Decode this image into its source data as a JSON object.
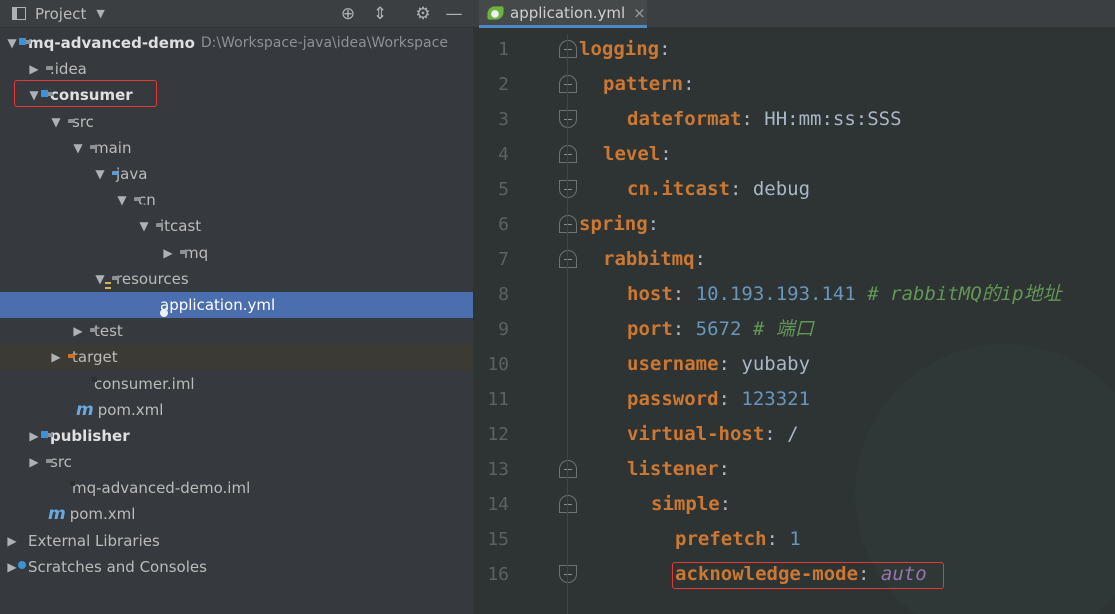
{
  "project": {
    "header_title": "Project",
    "icons": {
      "locate": "crosshair-icon",
      "collapse": "collapse-all-icon",
      "settings": "gear-icon",
      "hide": "minimize-icon"
    },
    "tree": [
      {
        "label": "mq-advanced-demo",
        "path": "D:\\Workspace-java\\idea\\Workspace"
      },
      {
        "label": ".idea"
      },
      {
        "label": "consumer"
      },
      {
        "label": "src"
      },
      {
        "label": "main"
      },
      {
        "label": "java"
      },
      {
        "label": "cn"
      },
      {
        "label": "itcast"
      },
      {
        "label": "mq"
      },
      {
        "label": "resources"
      },
      {
        "label": "application.yml"
      },
      {
        "label": "test"
      },
      {
        "label": "target"
      },
      {
        "label": "consumer.iml"
      },
      {
        "label": "pom.xml"
      },
      {
        "label": "publisher"
      },
      {
        "label": "src"
      },
      {
        "label": "mq-advanced-demo.iml"
      },
      {
        "label": "pom.xml"
      },
      {
        "label": "External Libraries"
      },
      {
        "label": "Scratches and Consoles"
      }
    ],
    "maven_glyph": "m"
  },
  "editor": {
    "tab_label": "application.yml",
    "tab_close": "×",
    "line_numbers": [
      "1",
      "2",
      "3",
      "4",
      "5",
      "6",
      "7",
      "8",
      "9",
      "10",
      "11",
      "12",
      "13",
      "14",
      "15",
      "16"
    ],
    "lines": [
      {
        "key": "logging",
        "sep": ":"
      },
      {
        "key": "pattern",
        "sep": ":"
      },
      {
        "key": "dateformat",
        "sep": ": ",
        "value": "HH:mm:ss:SSS"
      },
      {
        "key": "level",
        "sep": ":"
      },
      {
        "key": "cn.itcast",
        "sep": ": ",
        "value": "debug"
      },
      {
        "key": "spring",
        "sep": ":"
      },
      {
        "key": "rabbitmq",
        "sep": ":"
      },
      {
        "key": "host",
        "sep": ": ",
        "value": "10.193.193.141",
        "comment": "# rabbitMQ的ip地址"
      },
      {
        "key": "port",
        "sep": ": ",
        "value": "5672",
        "comment": "# 端口"
      },
      {
        "key": "username",
        "sep": ": ",
        "value": "yubaby"
      },
      {
        "key": "password",
        "sep": ": ",
        "value": "123321"
      },
      {
        "key": "virtual-host",
        "sep": ": ",
        "value": "/"
      },
      {
        "key": "listener",
        "sep": ":"
      },
      {
        "key": "simple",
        "sep": ":"
      },
      {
        "key": "prefetch",
        "sep": ": ",
        "value": "1"
      },
      {
        "key": "acknowledge-mode",
        "sep": ": ",
        "value": "auto"
      }
    ]
  },
  "colors": {
    "highlight_box": "#e53935",
    "selection": "#4b6eaf",
    "yaml_key": "#cc7832",
    "yaml_number": "#6897bb",
    "yaml_comment": "#629755"
  }
}
